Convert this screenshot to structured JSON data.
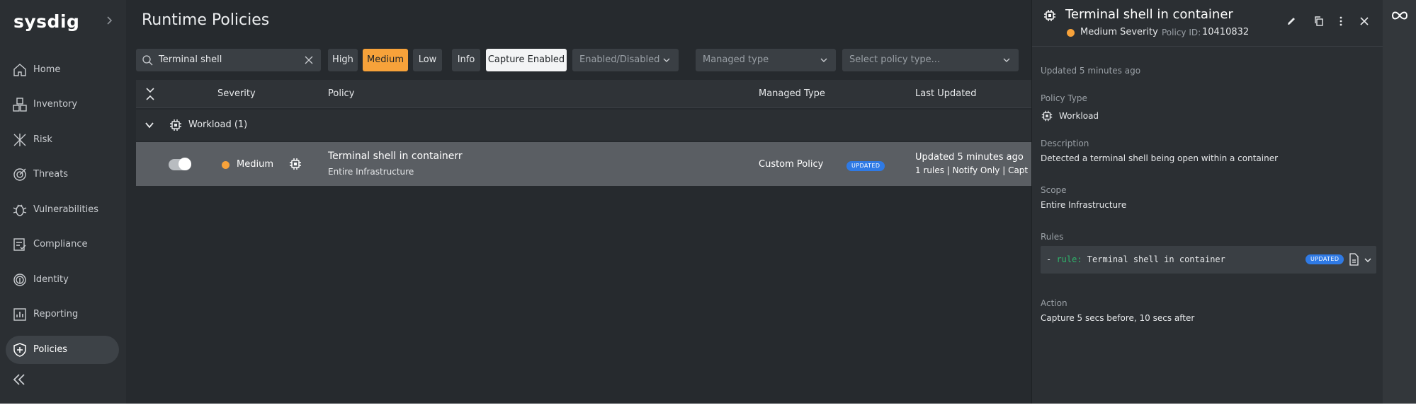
{
  "sidebar": {
    "logo": "sysdig",
    "items": [
      {
        "label": "Home",
        "icon": "home-icon"
      },
      {
        "label": "Inventory",
        "icon": "inventory-icon"
      },
      {
        "label": "Risk",
        "icon": "risk-icon"
      },
      {
        "label": "Threats",
        "icon": "threats-icon"
      },
      {
        "label": "Vulnerabilities",
        "icon": "bug-icon"
      },
      {
        "label": "Compliance",
        "icon": "compliance-icon"
      },
      {
        "label": "Identity",
        "icon": "fingerprint-icon"
      },
      {
        "label": "Reporting",
        "icon": "reporting-icon"
      },
      {
        "label": "Policies",
        "icon": "shield-icon",
        "active": true
      }
    ]
  },
  "main": {
    "title": "Runtime Policies",
    "search": {
      "value": "Terminal shell"
    },
    "severity_filters": [
      {
        "label": "High",
        "selected": false
      },
      {
        "label": "Medium",
        "selected": true
      },
      {
        "label": "Low",
        "selected": false
      },
      {
        "label": "Info",
        "selected": false
      }
    ],
    "capture_filter": {
      "label": "Capture Enabled",
      "selected": true
    },
    "dropdowns": {
      "enabled": "Enabled/Disabled",
      "managed": "Managed type",
      "policy_type": "Select policy type..."
    },
    "columns": {
      "severity": "Severity",
      "policy": "Policy",
      "managed_type": "Managed Type",
      "last_updated": "Last Updated"
    },
    "group": {
      "label": "Workload (1)"
    },
    "rows": [
      {
        "enabled": true,
        "severity": "Medium",
        "name": "Terminal shell in containerr",
        "scope": "Entire Infrastructure",
        "managed_type": "Custom Policy",
        "badge": "UPDATED",
        "updated": "Updated 5 minutes ago",
        "summary": "1 rules | Notify Only | Capt"
      }
    ]
  },
  "panel": {
    "title": "Terminal shell in container",
    "severity": "Medium Severity",
    "policy_id_label": "Policy ID:",
    "policy_id": "10410832",
    "updated": "Updated 5 minutes ago",
    "policy_type_label": "Policy Type",
    "policy_type": "Workload",
    "description_label": "Description",
    "description": "Detected a terminal shell being open within a container",
    "scope_label": "Scope",
    "scope": "Entire Infrastructure",
    "rules_label": "Rules",
    "rule_prefix": "- ",
    "rule_key": "rule:",
    "rule_value": " Terminal shell in container",
    "rule_badge": "UPDATED",
    "action_label": "Action",
    "action": "Capture 5 secs before,  10 secs after"
  },
  "colors": {
    "accent_orange": "#f7a23a",
    "badge_blue": "#2f7ae5",
    "rule_green": "#2fb36b",
    "background": "#262a2e"
  }
}
